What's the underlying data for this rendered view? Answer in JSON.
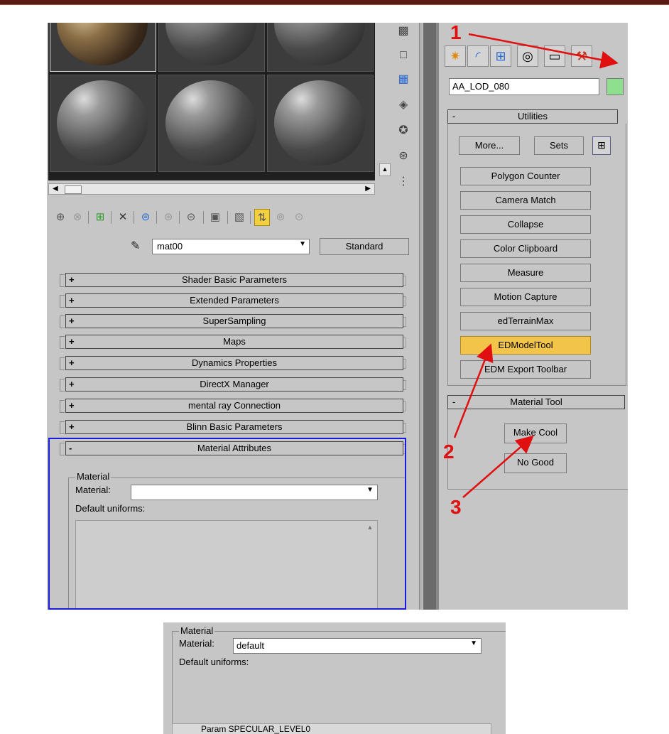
{
  "annotations": {
    "n1": "1",
    "n2": "2",
    "n3": "3"
  },
  "material_editor": {
    "material_name": "mat00",
    "type_button": "Standard",
    "rollouts": [
      {
        "sign": "+",
        "label": "Shader Basic Parameters"
      },
      {
        "sign": "+",
        "label": "Extended Parameters"
      },
      {
        "sign": "+",
        "label": "SuperSampling"
      },
      {
        "sign": "+",
        "label": "Maps"
      },
      {
        "sign": "+",
        "label": "Dynamics Properties"
      },
      {
        "sign": "+",
        "label": "DirectX Manager"
      },
      {
        "sign": "+",
        "label": "mental ray Connection"
      },
      {
        "sign": "+",
        "label": "Blinn Basic Parameters"
      },
      {
        "sign": "-",
        "label": "Material Attributes"
      }
    ],
    "group_label": "Material",
    "material_label": "Material:",
    "material_value": "",
    "uniforms_label": "Default uniforms:"
  },
  "command_panel": {
    "object_name": "AA_LOD_080",
    "object_color": "#8ee08e",
    "utilities": {
      "sign": "-",
      "title": "Utilities",
      "more_label": "More...",
      "sets_label": "Sets",
      "buttons": [
        "Polygon Counter",
        "Camera Match",
        "Collapse",
        "Color Clipboard",
        "Measure",
        "Motion Capture",
        "edTerrainMax",
        "EDModelTool",
        "EDM Export Toolbar"
      ],
      "highlighted": "EDModelTool"
    },
    "material_tool": {
      "sign": "-",
      "title": "Material Tool",
      "buttons": [
        "Make Cool",
        "No Good"
      ]
    }
  },
  "bottom_snippet": {
    "group_label": "Material",
    "material_label": "Material:",
    "material_value": "default",
    "uniforms_label": "Default uniforms:",
    "row_text": "Param SPECULAR_LEVEL0"
  }
}
